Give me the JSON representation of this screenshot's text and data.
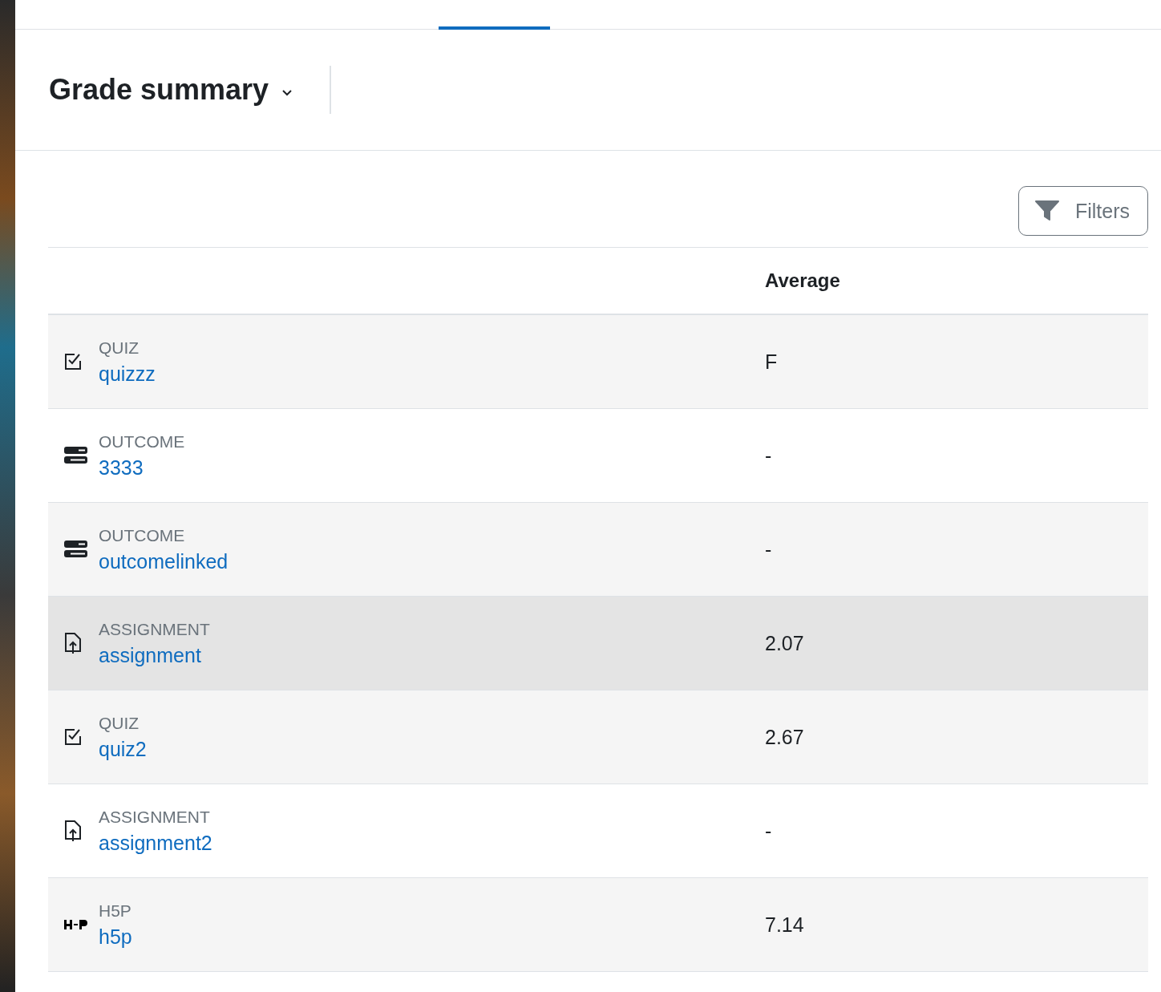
{
  "page": {
    "title": "Grade summary"
  },
  "filters_button": {
    "label": "Filters"
  },
  "table": {
    "columns": [
      "Average"
    ],
    "rows": [
      {
        "kind": "quiz",
        "type": "QUIZ",
        "name": "quizzz",
        "average": "F",
        "highlighted": false
      },
      {
        "kind": "outcome",
        "type": "OUTCOME",
        "name": "3333",
        "average": "-",
        "highlighted": false
      },
      {
        "kind": "outcome",
        "type": "OUTCOME",
        "name": "outcomelinked",
        "average": "-",
        "highlighted": false
      },
      {
        "kind": "assignment",
        "type": "ASSIGNMENT",
        "name": "assignment",
        "average": "2.07",
        "highlighted": true
      },
      {
        "kind": "quiz",
        "type": "QUIZ",
        "name": "quiz2",
        "average": "2.67",
        "highlighted": false
      },
      {
        "kind": "assignment",
        "type": "ASSIGNMENT",
        "name": "assignment2",
        "average": "-",
        "highlighted": false
      },
      {
        "kind": "h5p",
        "type": "H5P",
        "name": "h5p",
        "average": "7.14",
        "highlighted": false
      }
    ]
  }
}
